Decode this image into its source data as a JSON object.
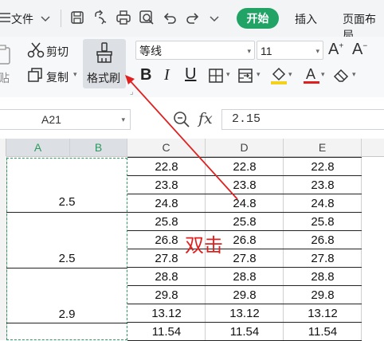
{
  "topbar": {
    "file_label": "文件",
    "tabs": [
      {
        "label": "开始",
        "active": true
      },
      {
        "label": "插入",
        "active": false
      },
      {
        "label": "页面布局",
        "active": false
      }
    ]
  },
  "ribbon": {
    "paste_label": "贴",
    "cut_label": "剪切",
    "copy_label": "复制",
    "format_painter_label": "格式刷",
    "font_name": "等线",
    "font_size": "11"
  },
  "formula_bar": {
    "name_box": "A21",
    "fx_label": "fx",
    "value": "2.15"
  },
  "columns": [
    "A",
    "B",
    "C",
    "D",
    "E"
  ],
  "sheet": {
    "merged_ab": [
      "2.5",
      "2.5",
      "2.9"
    ],
    "rows": [
      [
        "22.8",
        "22.8",
        "22.8"
      ],
      [
        "23.8",
        "23.8",
        "23.8"
      ],
      [
        "24.8",
        "24.8",
        "24.8"
      ],
      [
        "25.8",
        "25.8",
        "25.8"
      ],
      [
        "26.8",
        "26.8",
        "26.8"
      ],
      [
        "27.8",
        "27.8",
        "27.8"
      ],
      [
        "28.8",
        "28.8",
        "28.8"
      ],
      [
        "29.8",
        "29.8",
        "29.8"
      ],
      [
        "13.12",
        "13.12",
        "13.12"
      ],
      [
        "11.54",
        "11.54",
        "11.54"
      ]
    ]
  },
  "annotation": "双击",
  "colors": {
    "accent": "#21a366",
    "arrow": "#e02020",
    "selection": "#2a9a5e"
  }
}
